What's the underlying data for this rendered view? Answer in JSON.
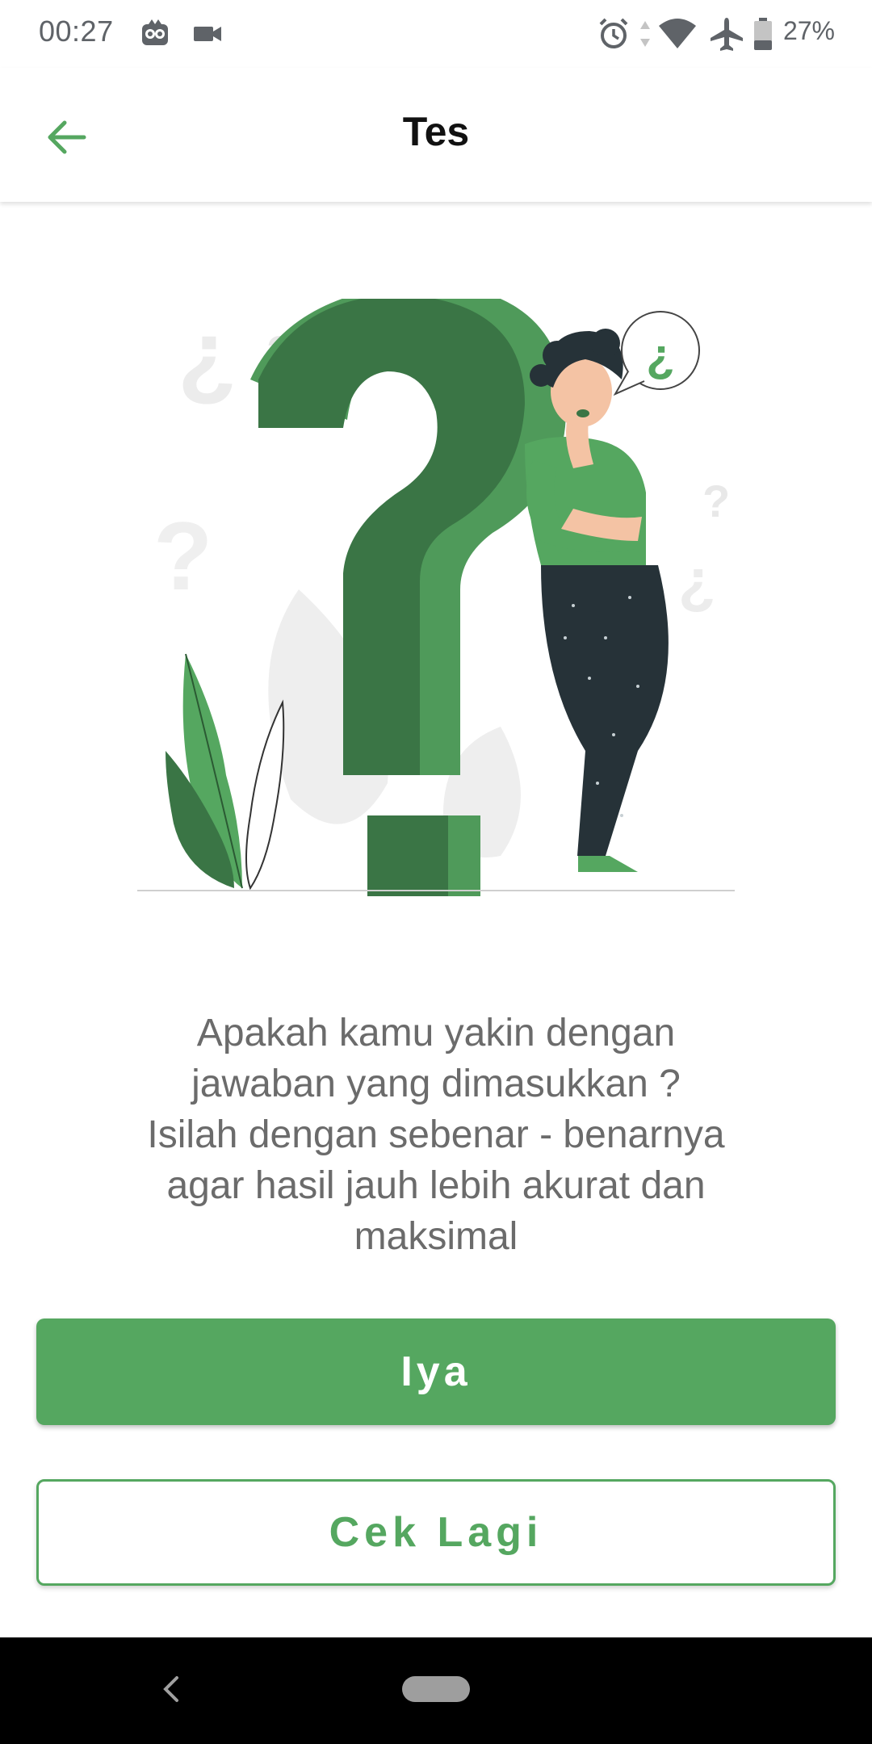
{
  "status_bar": {
    "time": "00:27",
    "battery": "27%",
    "icons": [
      "owl-app-icon",
      "video-camera-icon",
      "alarm-icon",
      "data-arrows-icon",
      "wifi-icon",
      "airplane-mode-icon",
      "battery-icon"
    ]
  },
  "app_bar": {
    "title": "Tes",
    "back_icon": "arrow-left-icon",
    "accent_color": "#55a760"
  },
  "illustration": {
    "speech_bubble_text": "¿",
    "decor_marks": [
      "¿",
      "?",
      "?",
      "?",
      "¿"
    ]
  },
  "message": {
    "line1": "Apakah kamu yakin dengan",
    "line2": "jawaban yang dimasukkan ?",
    "line3": "Isilah dengan sebenar - benarnya",
    "line4": "agar hasil jauh lebih akurat dan",
    "line5": "maksimal"
  },
  "buttons": {
    "yes_label": "Iya",
    "check_again_label": "Cek Lagi"
  },
  "nav_bar": {
    "back_icon": "chevron-left-icon",
    "home_icon": "home-pill-icon"
  },
  "colors": {
    "primary": "#55a760",
    "dark_green": "#3a7545",
    "text_gray": "#6b6b6b"
  }
}
